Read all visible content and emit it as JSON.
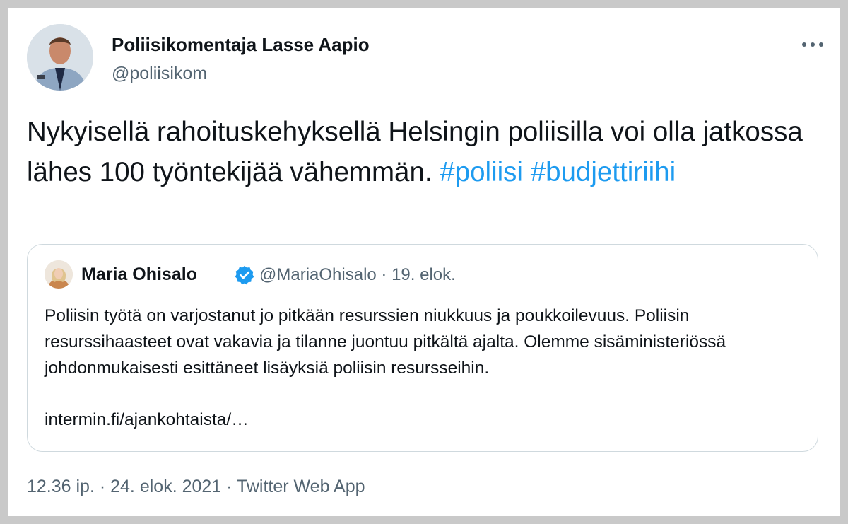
{
  "author": {
    "name": "Poliisikomentaja Lasse Aapio",
    "handle": "@poliisikom"
  },
  "more_icon": "more-horizontal-icon",
  "tweet": {
    "text": "Nykyisellä rahoituskehyksellä Helsingin poliisilla voi olla jatkossa lähes 100 työntekijää vähemmän. ",
    "hashtags": [
      "#poliisi",
      "#budjettiriihi"
    ]
  },
  "quoted": {
    "name": "Maria Ohisalo",
    "verified_icon": "verified-badge-icon",
    "meta": "@MariaOhisalo · 19. elok.",
    "body": "Poliisin työtä on varjostanut jo pitkään resurssien niukkuus ja poukkoilevuus. Poliisin resurssihaasteet ovat vakavia ja tilanne juontuu pitkältä ajalta. Olemme sisäministeriössä johdonmukaisesti esittäneet lisäyksiä poliisin resursseihin.",
    "link": "intermin.fi/ajankohtaista/…"
  },
  "footer": {
    "timestamp": "12.36 ip. · 24. elok. 2021 · Twitter Web App"
  },
  "colors": {
    "link": "#1d9bf0",
    "muted": "#536471",
    "text": "#0f1419",
    "border": "#cfd9de"
  }
}
